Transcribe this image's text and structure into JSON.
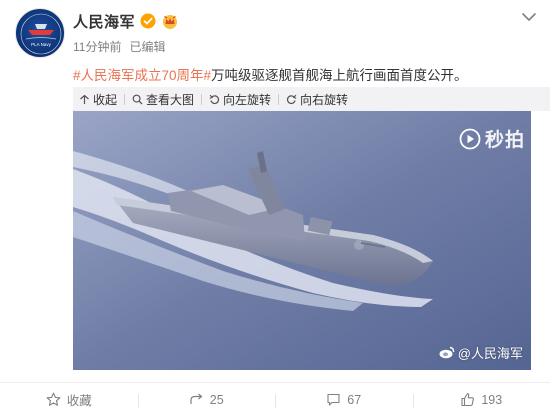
{
  "account": {
    "name": "人民海军",
    "time": "11分钟前",
    "edited": "已编辑",
    "avatar_text": "人民海军",
    "avatar_subtext": "PLA Navy"
  },
  "post": {
    "hashtag1": "#人民海军成立70周年#",
    "text": "万吨级驱逐舰首舰海上航行画面首度公开。"
  },
  "toolbar": {
    "collapse": "收起",
    "view_large": "查看大图",
    "rotate_left": "向左旋转",
    "rotate_right": "向右旋转"
  },
  "media": {
    "miaopai": "秒拍",
    "watermark": "@人民海军"
  },
  "actions": {
    "favorite": "收藏",
    "repost_count": "25",
    "comment_count": "67",
    "like_count": "193"
  },
  "colors": {
    "hashtag": "#eb7350",
    "verified": "#ffa200",
    "toolbar_bg": "#f2f2f5"
  }
}
